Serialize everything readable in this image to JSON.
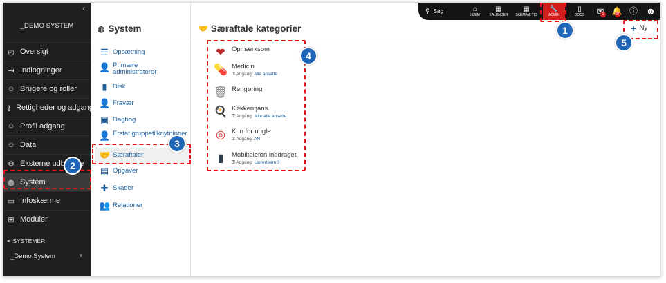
{
  "sidebar": {
    "title": "_DEMO SYSTEM",
    "items": [
      {
        "label": "Oversigt",
        "icon": "dashboard-icon"
      },
      {
        "label": "Indlogninger",
        "icon": "login-icon"
      },
      {
        "label": "Brugere og roller",
        "icon": "users-icon"
      },
      {
        "label": "Rettigheder og adgang",
        "icon": "key-icon"
      },
      {
        "label": "Profil adgang",
        "icon": "profile-access-icon"
      },
      {
        "label": "Data",
        "icon": "data-icon"
      },
      {
        "label": "Eksterne udbydere",
        "icon": "external-providers-icon"
      },
      {
        "label": "System",
        "icon": "globe-icon"
      },
      {
        "label": "Infoskærme",
        "icon": "info-screen-icon"
      },
      {
        "label": "Moduler",
        "icon": "modules-icon"
      }
    ],
    "systems_heading": "SYSTEMER",
    "system_selected": "_Demo System"
  },
  "middle": {
    "title": "System",
    "items": [
      {
        "label": "Opsætning"
      },
      {
        "label": "Primære administratorer"
      },
      {
        "label": "Disk"
      },
      {
        "label": "Fravær"
      },
      {
        "label": "Dagbog"
      },
      {
        "label": "Erstat gruppetilknytninger"
      },
      {
        "label": "Særaftaler"
      },
      {
        "label": "Opgaver"
      },
      {
        "label": "Skader"
      },
      {
        "label": "Relationer"
      }
    ]
  },
  "main": {
    "title": "Særaftale kategorier",
    "new_label": "Ny",
    "access_prefix": "Adgang:",
    "categories": [
      {
        "name": "Opmærksom",
        "access": ""
      },
      {
        "name": "Medicin",
        "access": "Alle ansatte"
      },
      {
        "name": "Rengøring",
        "access": ""
      },
      {
        "name": "Køkkentjans",
        "access": "Ikke alle ansatte"
      },
      {
        "name": "Kun for nogle",
        "access": "AN"
      },
      {
        "name": "Mobiltelefon inddraget",
        "access": "Lærerteam 3"
      }
    ]
  },
  "toolbar": {
    "search_label": "Søg",
    "home_label": "HJEM",
    "calendar_label": "KALENDER",
    "schedule_label": "SKEMA & TID",
    "admin_label": "ADMIN",
    "docs_label": "DOCS",
    "mail_badge": "1",
    "notifications_badge": "37"
  },
  "callouts": [
    "1",
    "2",
    "3",
    "4",
    "5"
  ],
  "colors": {
    "accent": "#1f66b8",
    "highlight": "#e1141c",
    "sidebar": "#1f1f1f"
  }
}
